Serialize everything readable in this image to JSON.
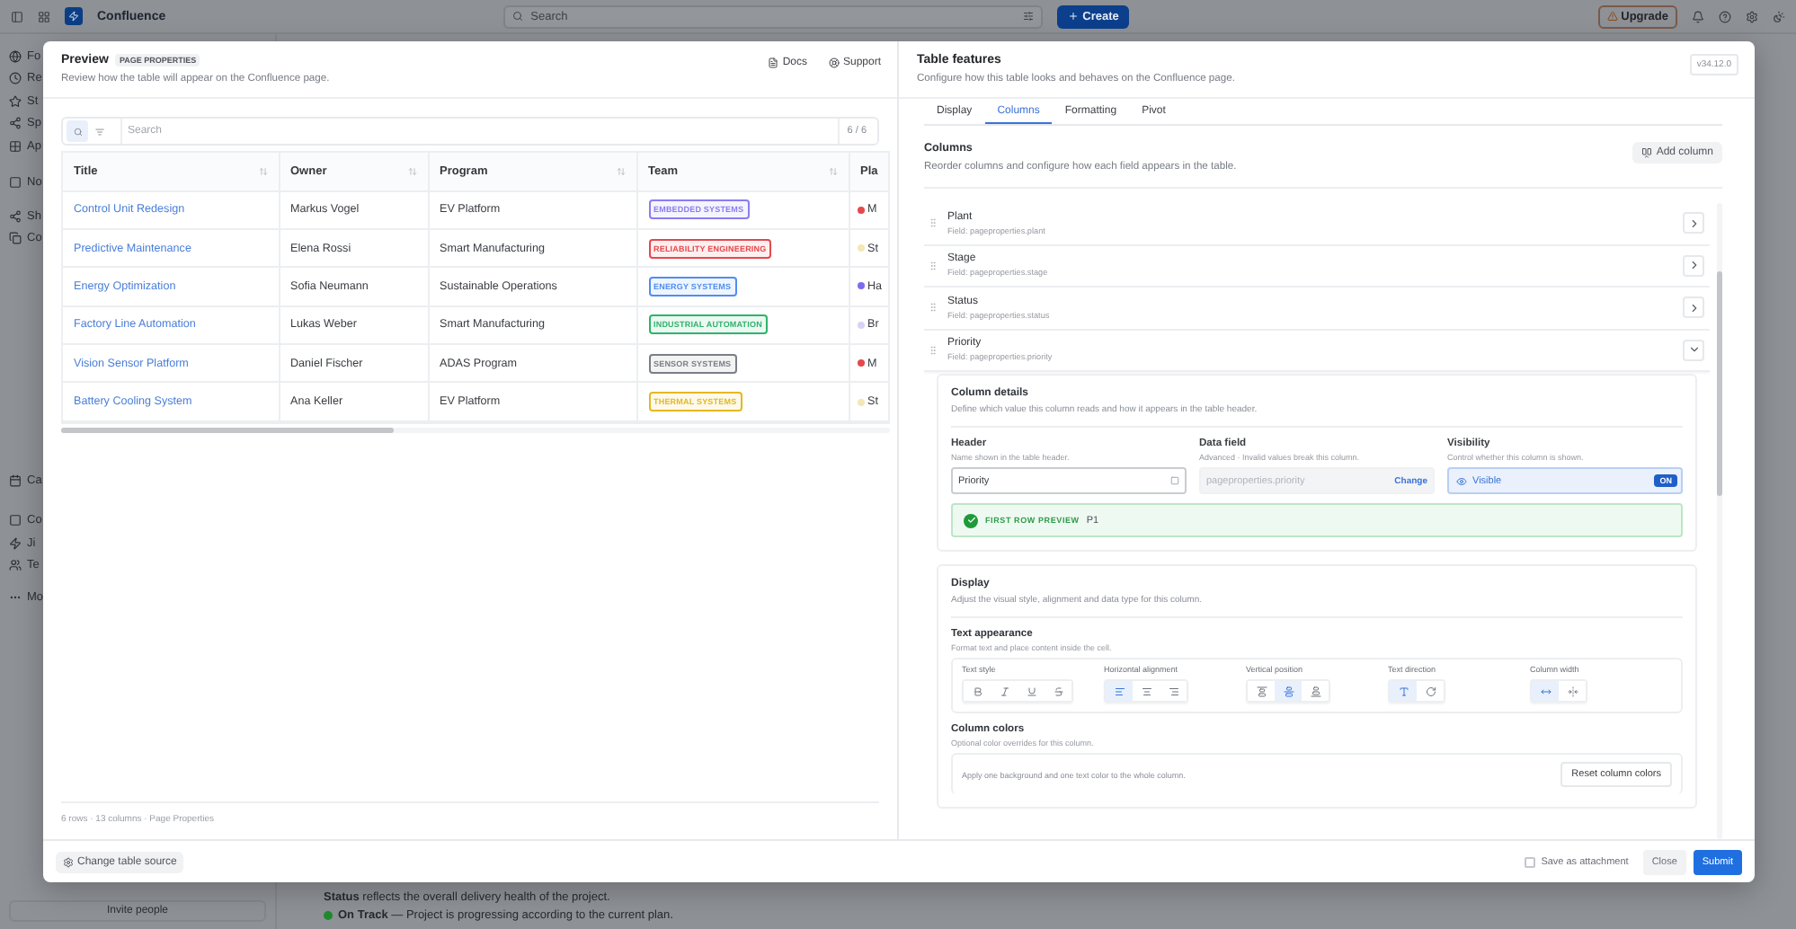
{
  "topbar": {
    "product": "Confluence",
    "search": {
      "placeholder": "Search"
    },
    "create_button": "Create",
    "upgrade_button": "Upgrade"
  },
  "sidebar": {
    "items": [
      {
        "label": "Fo"
      },
      {
        "label": "Re"
      },
      {
        "label": "St"
      },
      {
        "label": "Sp"
      },
      {
        "label": "Ap"
      },
      {
        "label": "No"
      },
      {
        "label": "Sh"
      },
      {
        "label": "Co"
      },
      {
        "label": "Ca"
      },
      {
        "label": "Co"
      },
      {
        "label": "Ji"
      },
      {
        "label": "Te"
      },
      {
        "label": "Mo"
      }
    ],
    "invite_button": "Invite people"
  },
  "page": {
    "lines": [
      {
        "text": "**Status** reflects the overall delivery health of the project."
      },
      {
        "text": "**On Track** — Project is progressing according to the current plan.",
        "color": "#1f8a2e"
      }
    ]
  },
  "preview": {
    "title": "Preview",
    "badge": "PAGE PROPERTIES",
    "subtitle": "Review how the table will appear on the Confluence page.",
    "links": [
      "Docs",
      "Support"
    ],
    "search": {
      "placeholder": "Search",
      "count": "6 / 6"
    },
    "table": {
      "columns": [
        "Title",
        "Owner",
        "Program",
        "Team",
        "Pla"
      ],
      "rows": [
        {
          "title": "Control Unit Redesign",
          "owner": "Markus Vogel",
          "program": "EV Platform",
          "team": {
            "label": "EMBEDDED SYSTEMS",
            "color": "#8b7cf0"
          },
          "column_5": {
            "text": "M",
            "color": "#e5484d"
          }
        },
        {
          "title": "Predictive Maintenance",
          "owner": "Elena Rossi",
          "program": "Smart Manufacturing",
          "team": {
            "label": "RELIABILITY ENGINEERING",
            "color": "#e5484d"
          },
          "column_5": {
            "text": "St",
            "color": "#f3e7b5"
          }
        },
        {
          "title": "Energy Optimization",
          "owner": "Sofia Neumann",
          "program": "Sustainable Operations",
          "team": {
            "label": "ENERGY SYSTEMS",
            "color": "#4f8ef0"
          },
          "column_5": {
            "text": "Ha",
            "color": "#7c6cf0"
          }
        },
        {
          "title": "Factory Line Automation",
          "owner": "Lukas Weber",
          "program": "Smart Manufacturing",
          "team": {
            "label": "INDUSTRIAL AUTOMATION",
            "color": "#2fb36b"
          },
          "column_5": {
            "text": "Br",
            "color": "#d6d3f5"
          }
        },
        {
          "title": "Vision Sensor Platform",
          "owner": "Daniel Fischer",
          "program": "ADAS Program",
          "team": {
            "label": "SENSOR SYSTEMS",
            "color": "#7a7f87"
          },
          "column_5": {
            "text": "M",
            "color": "#e5484d"
          }
        },
        {
          "title": "Battery Cooling System",
          "owner": "Ana Keller",
          "program": "EV Platform",
          "team": {
            "label": "THERMAL SYSTEMS",
            "color": "#e5b820"
          },
          "column_5": {
            "text": "St",
            "color": "#f3e7b5"
          }
        }
      ]
    },
    "meta": "6 rows · 13 columns · Page Properties"
  },
  "features": {
    "title": "Table features",
    "subtitle": "Configure how this table looks and behaves on the Confluence page.",
    "version": "v34.12.0",
    "tabs": [
      {
        "label": "Display",
        "selected": false
      },
      {
        "label": "Columns",
        "selected": true
      },
      {
        "label": "Formatting",
        "selected": false
      },
      {
        "label": "Pivot",
        "selected": false
      }
    ],
    "section": {
      "title": "Columns",
      "subtitle": "Reorder columns and configure how each field appears in the table.",
      "add_button": "Add column"
    },
    "columns": [
      {
        "name": "Plant",
        "field": "Field: pageproperties.plant",
        "expanded": false
      },
      {
        "name": "Stage",
        "field": "Field: pageproperties.stage",
        "expanded": false
      },
      {
        "name": "Status",
        "field": "Field: pageproperties.status",
        "expanded": false
      },
      {
        "name": "Priority",
        "field": "Field: pageproperties.priority",
        "expanded": true
      }
    ],
    "details": {
      "title": "Column details",
      "subtitle": "Define which value this column reads and how it appears in the table header.",
      "header": {
        "label": "Header",
        "hint": "Name shown in the table header.",
        "value": "Priority"
      },
      "data_field": {
        "label": "Data field",
        "hint": "Advanced · Invalid values break this column.",
        "value": "pageproperties.priority",
        "disabled": true,
        "action": "Change"
      },
      "visibility": {
        "label": "Visibility",
        "hint": "Control whether this column is shown.",
        "value": "Visible",
        "on": true,
        "badge": "ON"
      },
      "preview": {
        "label": "FIRST ROW PREVIEW",
        "value": "P1"
      }
    },
    "display": {
      "title": "Display",
      "subtitle": "Adjust the visual style, alignment and data type for this column.",
      "text_appearance": {
        "title": "Text appearance",
        "subtitle": "Format text and place content inside the cell.",
        "groups": [
          {
            "label": "Text style",
            "buttons": [
              {
                "kind": "bold",
                "selected": false
              },
              {
                "kind": "italic",
                "selected": false
              },
              {
                "kind": "underline",
                "selected": false
              },
              {
                "kind": "strike",
                "selected": false
              }
            ]
          },
          {
            "label": "Horizontal alignment",
            "buttons": [
              {
                "kind": "align-left",
                "selected": true
              },
              {
                "kind": "align-center",
                "selected": false
              },
              {
                "kind": "align-right",
                "selected": false
              }
            ]
          },
          {
            "label": "Vertical position",
            "buttons": [
              {
                "kind": "align-top",
                "selected": false
              },
              {
                "kind": "align-middle",
                "selected": true
              },
              {
                "kind": "align-bottom",
                "selected": false
              }
            ]
          },
          {
            "label": "Text direction",
            "buttons": [
              {
                "kind": "horizontal-text",
                "selected": true
              },
              {
                "kind": "rotated-text",
                "selected": false
              }
            ]
          },
          {
            "label": "Column width",
            "buttons": [
              {
                "kind": "fit-width",
                "selected": true
              },
              {
                "kind": "fixed-width",
                "selected": false
              }
            ]
          }
        ]
      },
      "colors": {
        "title": "Column colors",
        "subtitle": "Optional color overrides for this column.",
        "note": "Apply one background and one text color to the whole column.",
        "reset_button": "Reset column colors"
      }
    }
  },
  "footer": {
    "change_source": "Change table source",
    "save_attachment": {
      "label": "Save as attachment",
      "checked": false
    },
    "buttons": [
      {
        "label": "Close",
        "kind": "secondary"
      },
      {
        "label": "Submit",
        "kind": "primary"
      }
    ]
  }
}
